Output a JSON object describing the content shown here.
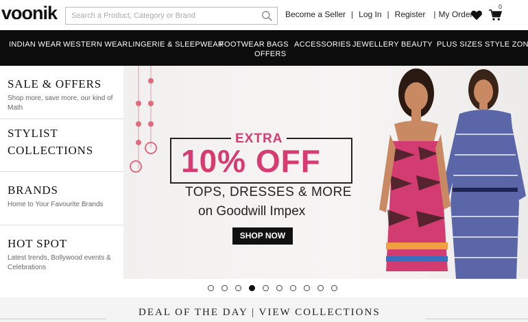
{
  "brand": {
    "logo": "voonik"
  },
  "search": {
    "placeholder": "Search a Product, Category or Brand"
  },
  "header_links": {
    "become_seller": "Become a Seller",
    "login": "Log In",
    "register": "Register",
    "my_orders": "My Orders",
    "separator": "|"
  },
  "cart": {
    "count": "0"
  },
  "nav": {
    "items": [
      {
        "label": "INDIAN WEAR"
      },
      {
        "label": "WESTERN WEAR"
      },
      {
        "label": "LINGERIE & SLEEPWEAR"
      },
      {
        "label": "FOOTWEAR"
      },
      {
        "label": "BAGS"
      },
      {
        "label": "ACCESSORIES"
      },
      {
        "label": "JEWELLERY"
      },
      {
        "label": "BEAUTY"
      },
      {
        "label": "PLUS SIZES"
      },
      {
        "label": "STYLE ZONE"
      },
      {
        "label": "OFFERS"
      }
    ]
  },
  "sidebar": {
    "blocks": [
      {
        "title": "SALE & OFFERS",
        "subtitle": "Shop more, save more, our kind of Math"
      },
      {
        "title": "STYLIST COLLECTIONS",
        "subtitle": ""
      },
      {
        "title": "BRANDS",
        "subtitle": "Home to Your Favourite Brands"
      },
      {
        "title": "HOT SPOT",
        "subtitle": "Latest trends, Bollywood events & Celebrations"
      }
    ]
  },
  "banner": {
    "extra": "EXTRA",
    "discount": "10% OFF",
    "items": "TOPS, DRESSES & MORE",
    "brand": "on Goodwill Impex",
    "cta": "SHOP NOW"
  },
  "carousel": {
    "total": 10,
    "active": 4
  },
  "bottom": {
    "heading": "DEAL OF THE DAY | VIEW COLLECTIONS"
  },
  "colors": {
    "accent": "#d83b72",
    "nav_bg": "#0c0c0c"
  }
}
